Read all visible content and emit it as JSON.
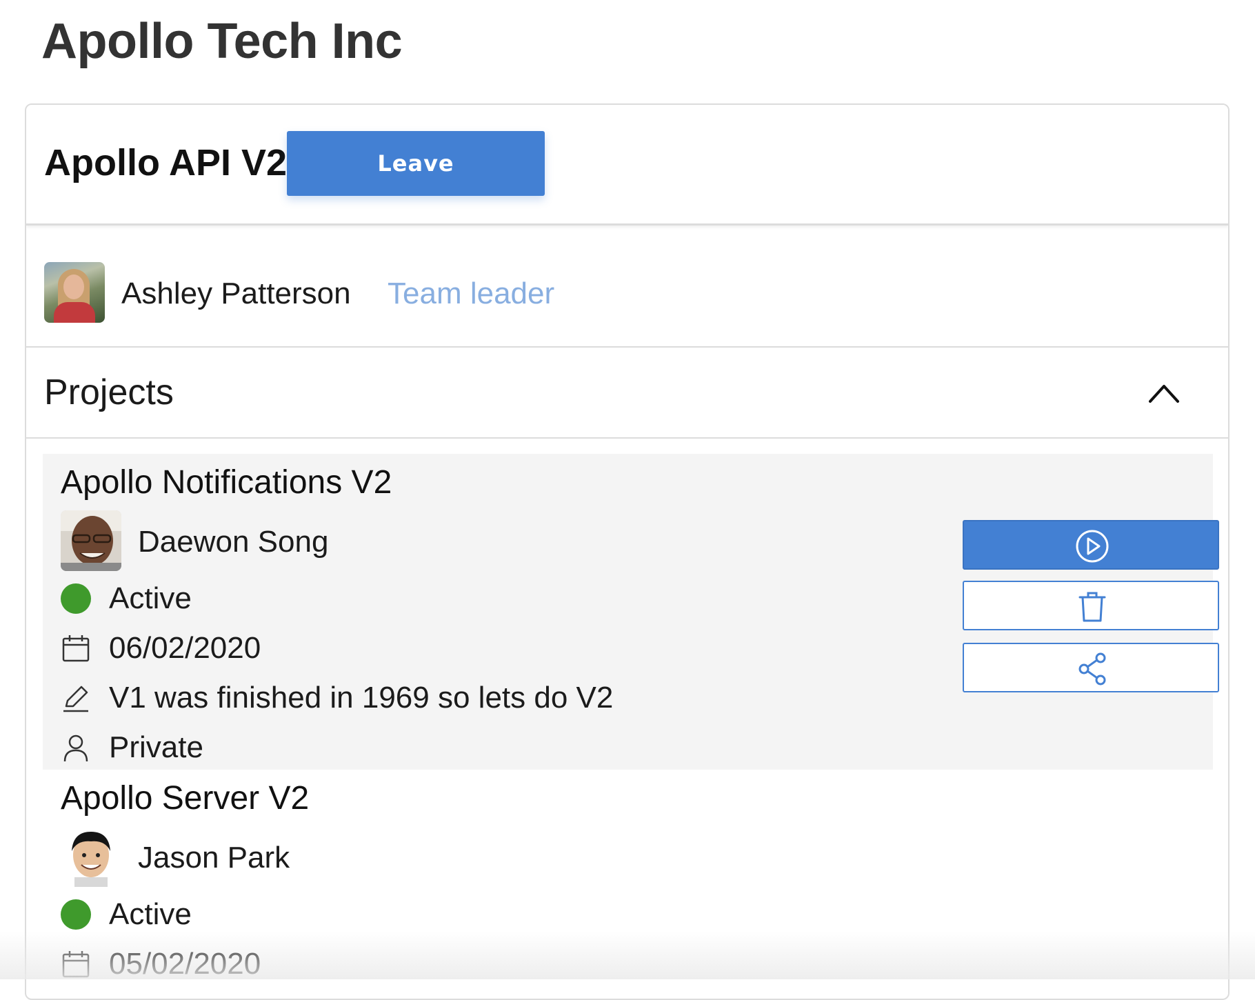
{
  "organization": {
    "name": "Apollo Tech Inc"
  },
  "team": {
    "name": "Apollo API V2",
    "leave_label": "Leave",
    "leader": {
      "name": "Ashley Patterson",
      "role": "Team leader",
      "avatar": "person-photo"
    }
  },
  "projects": {
    "title": "Projects",
    "toggle_icon": "chevron-up-icon",
    "items": [
      {
        "name": "Apollo Notifications V2",
        "owner": "Daewon Song",
        "status": "Active",
        "status_color": "#3f9a2c",
        "date": "06/02/2020",
        "description": "V1 was finished in 1969 so lets do V2",
        "visibility": "Private",
        "highlighted": true,
        "actions": [
          {
            "name": "run",
            "icon": "play-circle-icon"
          },
          {
            "name": "delete",
            "icon": "trash-icon"
          },
          {
            "name": "share",
            "icon": "share-icon"
          }
        ]
      },
      {
        "name": "Apollo Server V2",
        "owner": "Jason Park",
        "status": "Active",
        "status_color": "#3f9a2c",
        "date": "05/02/2020"
      }
    ]
  },
  "colors": {
    "accent": "#4380d3",
    "role_text": "#88aee0",
    "highlight_bg": "#f4f4f4",
    "border": "#dcdcdc"
  }
}
